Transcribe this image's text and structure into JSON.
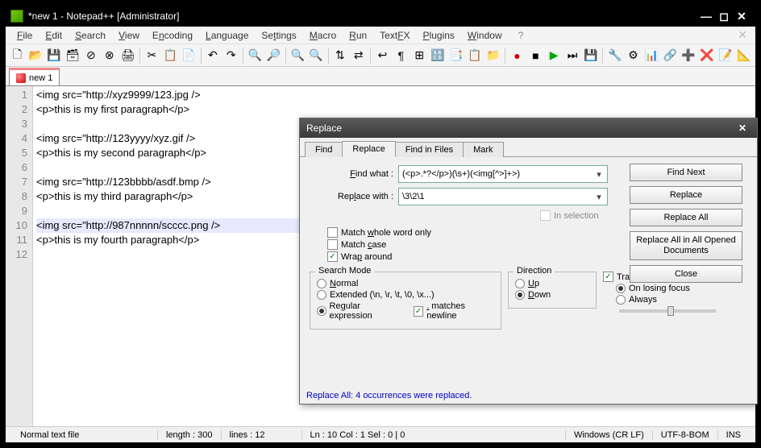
{
  "titlebar": {
    "title": "*new 1 - Notepad++ [Administrator]"
  },
  "menubar": {
    "items": [
      "File",
      "Edit",
      "Search",
      "View",
      "Encoding",
      "Language",
      "Settings",
      "Macro",
      "Run",
      "TextFX",
      "Plugins",
      "Window"
    ],
    "help": "?"
  },
  "tabs": {
    "active": "new 1"
  },
  "code": {
    "lines": [
      "<img src=\"http://xyz9999/123.jpg />",
      "<p>this is my first paragraph</p>",
      "",
      "<img src=\"http://123yyyy/xyz.gif />",
      "<p>this is my second paragraph</p>",
      "",
      "<img src=\"http://123bbbb/asdf.bmp />",
      "<p>this is my third paragraph</p>",
      "",
      "<img src=\"http://987nnnnn/scccc.png />",
      "<p>this is my fourth paragraph</p>",
      ""
    ],
    "highlight_line": 10
  },
  "statusbar": {
    "doctype": "Normal text file",
    "length": "length : 300",
    "lines": "lines : 12",
    "pos": "Ln : 10    Col : 1    Sel : 0 | 0",
    "eol": "Windows (CR LF)",
    "encoding": "UTF-8-BOM",
    "mode": "INS"
  },
  "dialog": {
    "title": "Replace",
    "tabs": [
      "Find",
      "Replace",
      "Find in Files",
      "Mark"
    ],
    "active_tab": 1,
    "find_label": "Find what :",
    "find_value": "(<p>.*?</p>)(\\s+)(<img[^>]+>)",
    "replace_label": "Replace with :",
    "replace_value": "\\3\\2\\1",
    "in_selection": "In selection",
    "btn_findnext": "Find Next",
    "btn_replace": "Replace",
    "btn_replaceall": "Replace All",
    "btn_replaceall_opened": "Replace All in All Opened Documents",
    "btn_close": "Close",
    "chk_whole": "Match whole word only",
    "chk_case": "Match case",
    "chk_wrap": "Wrap around",
    "grp_mode": "Search Mode",
    "mode_normal": "Normal",
    "mode_ext": "Extended (\\n, \\r, \\t, \\0, \\x...)",
    "mode_regex": "Regular expression",
    "chk_dotall": ". matches newline",
    "grp_dir": "Direction",
    "dir_up": "Up",
    "dir_down": "Down",
    "chk_trans": "Transparency",
    "trans_focus": "On losing focus",
    "trans_always": "Always",
    "status": "Replace All: 4 occurrences were replaced."
  }
}
